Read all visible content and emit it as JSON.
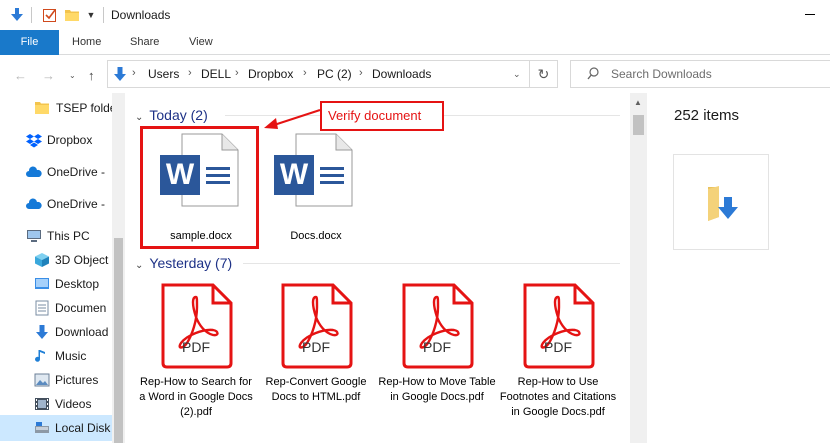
{
  "titlebar": {
    "title": "Downloads",
    "quick_access": [
      "arrow-down-icon",
      "checkbox-icon",
      "folder-icon",
      "dropdown-icon"
    ]
  },
  "ribbon": {
    "tabs": [
      {
        "label": "File",
        "active": true
      },
      {
        "label": "Home"
      },
      {
        "label": "Share"
      },
      {
        "label": "View"
      }
    ],
    "file_color": "#1979ca"
  },
  "address": {
    "path": [
      "Users",
      "DELL",
      "Dropbox",
      "PC (2)",
      "Downloads"
    ]
  },
  "search": {
    "placeholder": "Search Downloads"
  },
  "sidebar": {
    "items": [
      {
        "label": "TSEP folde",
        "icon": "folder-icon"
      },
      {
        "label": "Dropbox",
        "icon": "dropbox-icon"
      },
      {
        "label": "OneDrive -",
        "icon": "cloud-icon"
      },
      {
        "label": "OneDrive -",
        "icon": "cloud-icon"
      },
      {
        "label": "This PC",
        "icon": "computer-icon"
      },
      {
        "label": "3D Object",
        "icon": "cube-icon"
      },
      {
        "label": "Desktop",
        "icon": "desktop-icon"
      },
      {
        "label": "Documen",
        "icon": "document-icon"
      },
      {
        "label": "Download",
        "icon": "download-icon"
      },
      {
        "label": "Music",
        "icon": "music-icon"
      },
      {
        "label": "Pictures",
        "icon": "pictures-icon"
      },
      {
        "label": "Videos",
        "icon": "videos-icon"
      },
      {
        "label": "Local Disk",
        "icon": "disk-icon",
        "selected": true
      }
    ]
  },
  "groups": {
    "today": {
      "label": "Today (2)",
      "files": [
        {
          "name": "sample.docx",
          "type": "word"
        },
        {
          "name": "Docs.docx",
          "type": "word"
        }
      ]
    },
    "yesterday": {
      "label": "Yesterday (7)",
      "files": [
        {
          "name": "Rep-How to Search for a Word in Google Docs (2).pdf",
          "type": "pdf"
        },
        {
          "name": "Rep-Convert Google Docs to HTML.pdf",
          "type": "pdf"
        },
        {
          "name": "Rep-How to Move Table in Google Docs.pdf",
          "type": "pdf"
        },
        {
          "name": "Rep-How to Use Footnotes and Citations in Google Docs.pdf",
          "type": "pdf"
        }
      ]
    }
  },
  "pdf_badge": "PDF",
  "word_letter": "W",
  "preview": {
    "item_count": "252 items"
  },
  "annotation": {
    "callout": "Verify document",
    "color": "#e51313"
  },
  "colors": {
    "group_header": "#1e3287",
    "word_blue": "#2b579a",
    "pdf_red": "#e51313",
    "selected_bg": "#cce8ff"
  }
}
